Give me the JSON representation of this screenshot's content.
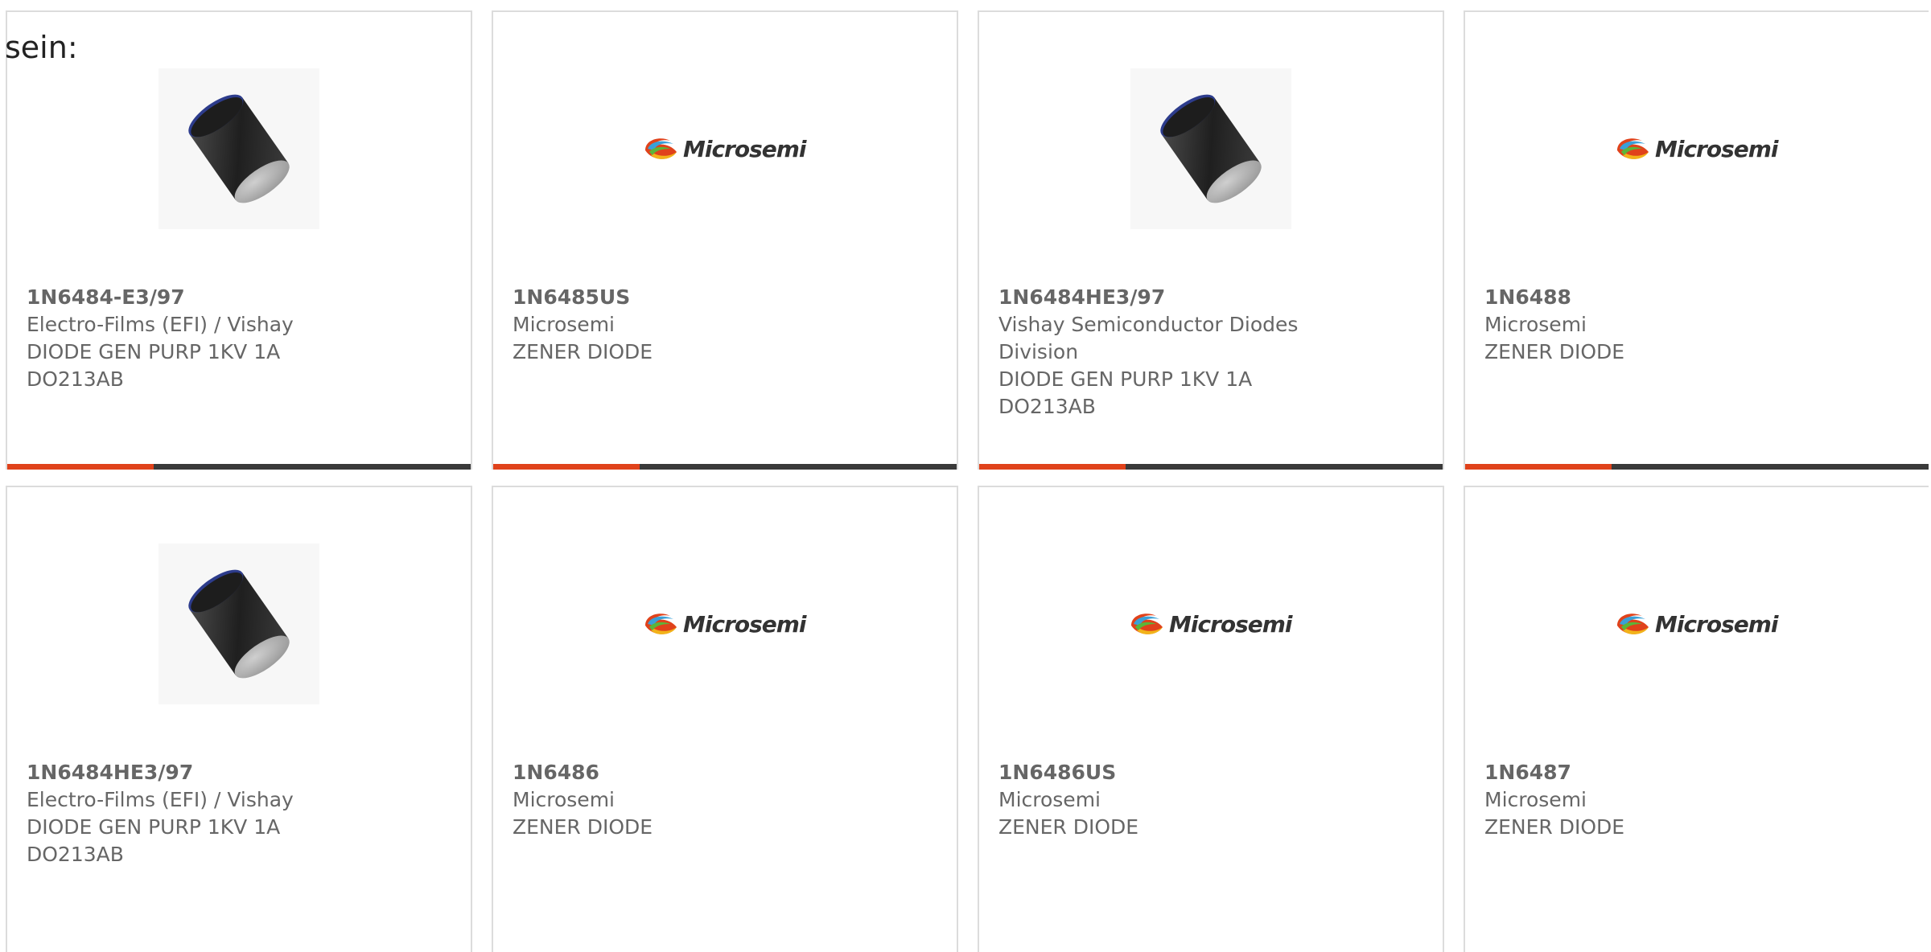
{
  "intro_text": "sein:",
  "colors": {
    "accent": "#e0421b",
    "bar": "#3a3a3a",
    "border": "#dcdcdc",
    "text": "#666666"
  },
  "products": [
    {
      "part_number": "1N6484-E3/97",
      "manufacturer": "Electro-Films (EFI) / Vishay",
      "description": "DIODE GEN PURP 1KV 1A DO213AB",
      "image": "diode-cylinder",
      "logo_text": ""
    },
    {
      "part_number": "1N6485US",
      "manufacturer": "Microsemi",
      "description": "ZENER DIODE",
      "image": "microsemi-logo",
      "logo_text": "Microsemi"
    },
    {
      "part_number": "1N6484HE3/97",
      "manufacturer": "Vishay Semiconductor Diodes Division",
      "description": "DIODE GEN PURP 1KV 1A DO213AB",
      "image": "diode-cylinder",
      "logo_text": ""
    },
    {
      "part_number": "1N6488",
      "manufacturer": "Microsemi",
      "description": "ZENER DIODE",
      "image": "microsemi-logo",
      "logo_text": "Microsemi"
    },
    {
      "part_number": "1N6484HE3/97",
      "manufacturer": "Electro-Films (EFI) / Vishay",
      "description": "DIODE GEN PURP 1KV 1A DO213AB",
      "image": "diode-cylinder",
      "logo_text": ""
    },
    {
      "part_number": "1N6486",
      "manufacturer": "Microsemi",
      "description": "ZENER DIODE",
      "image": "microsemi-logo",
      "logo_text": "Microsemi"
    },
    {
      "part_number": "1N6486US",
      "manufacturer": "Microsemi",
      "description": "ZENER DIODE",
      "image": "microsemi-logo",
      "logo_text": "Microsemi"
    },
    {
      "part_number": "1N6487",
      "manufacturer": "Microsemi",
      "description": "ZENER DIODE",
      "image": "microsemi-logo",
      "logo_text": "Microsemi"
    }
  ]
}
